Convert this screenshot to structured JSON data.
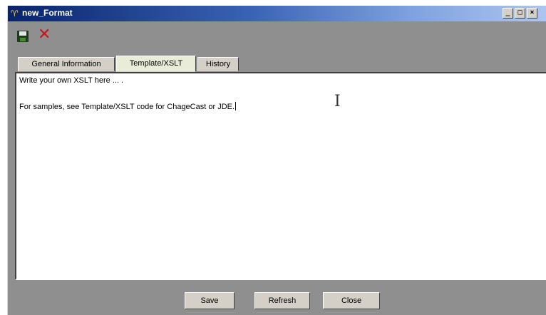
{
  "window": {
    "title": "new_Format",
    "minimize_label": "_",
    "maximize_label": "□",
    "close_label": "×"
  },
  "toolbar": {
    "save_icon": "save-icon",
    "close_icon": "close-icon",
    "close_glyph": "✕",
    "accent": "#c8141a"
  },
  "tabs": [
    {
      "label": "General Information",
      "active": false
    },
    {
      "label": "Template/XSLT",
      "active": true
    },
    {
      "label": "History",
      "active": false
    }
  ],
  "editor": {
    "lines": [
      "Write your own XSLT here ... .",
      "",
      "For samples, see Template/XSLT code for ChageCast or JDE."
    ]
  },
  "buttons": {
    "save": "Save",
    "refresh": "Refresh",
    "close": "Close"
  }
}
